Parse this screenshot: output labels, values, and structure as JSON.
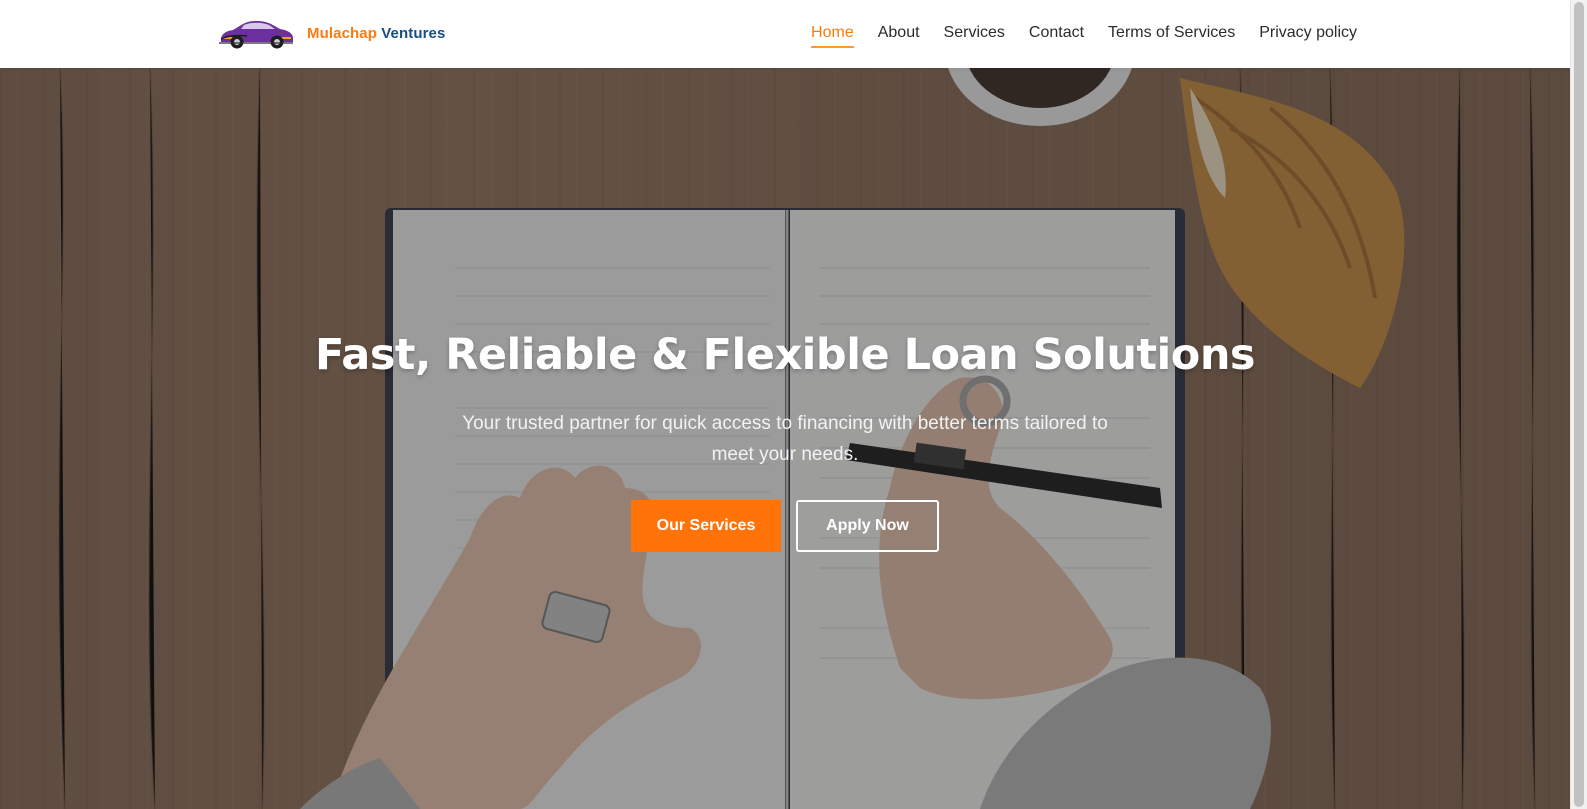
{
  "brand": {
    "name_part1": "Mulachap",
    "name_part2": "Ventures",
    "logo_icon": "car-logo-icon"
  },
  "nav": {
    "items": [
      {
        "label": "Home",
        "active": true
      },
      {
        "label": "About",
        "active": false
      },
      {
        "label": "Services",
        "active": false
      },
      {
        "label": "Contact",
        "active": false
      },
      {
        "label": "Terms of Services",
        "active": false
      },
      {
        "label": "Privacy policy",
        "active": false
      }
    ]
  },
  "hero": {
    "title": "Fast, Reliable & Flexible Loan Solutions",
    "subtitle": "Your trusted partner for quick access to financing with better terms tailored to meet your needs.",
    "primary_button": "Our Services",
    "secondary_button": "Apply Now"
  },
  "colors": {
    "accent": "#ff7308",
    "brand_blue": "#174e86",
    "text_dark": "#2c2c2c"
  }
}
